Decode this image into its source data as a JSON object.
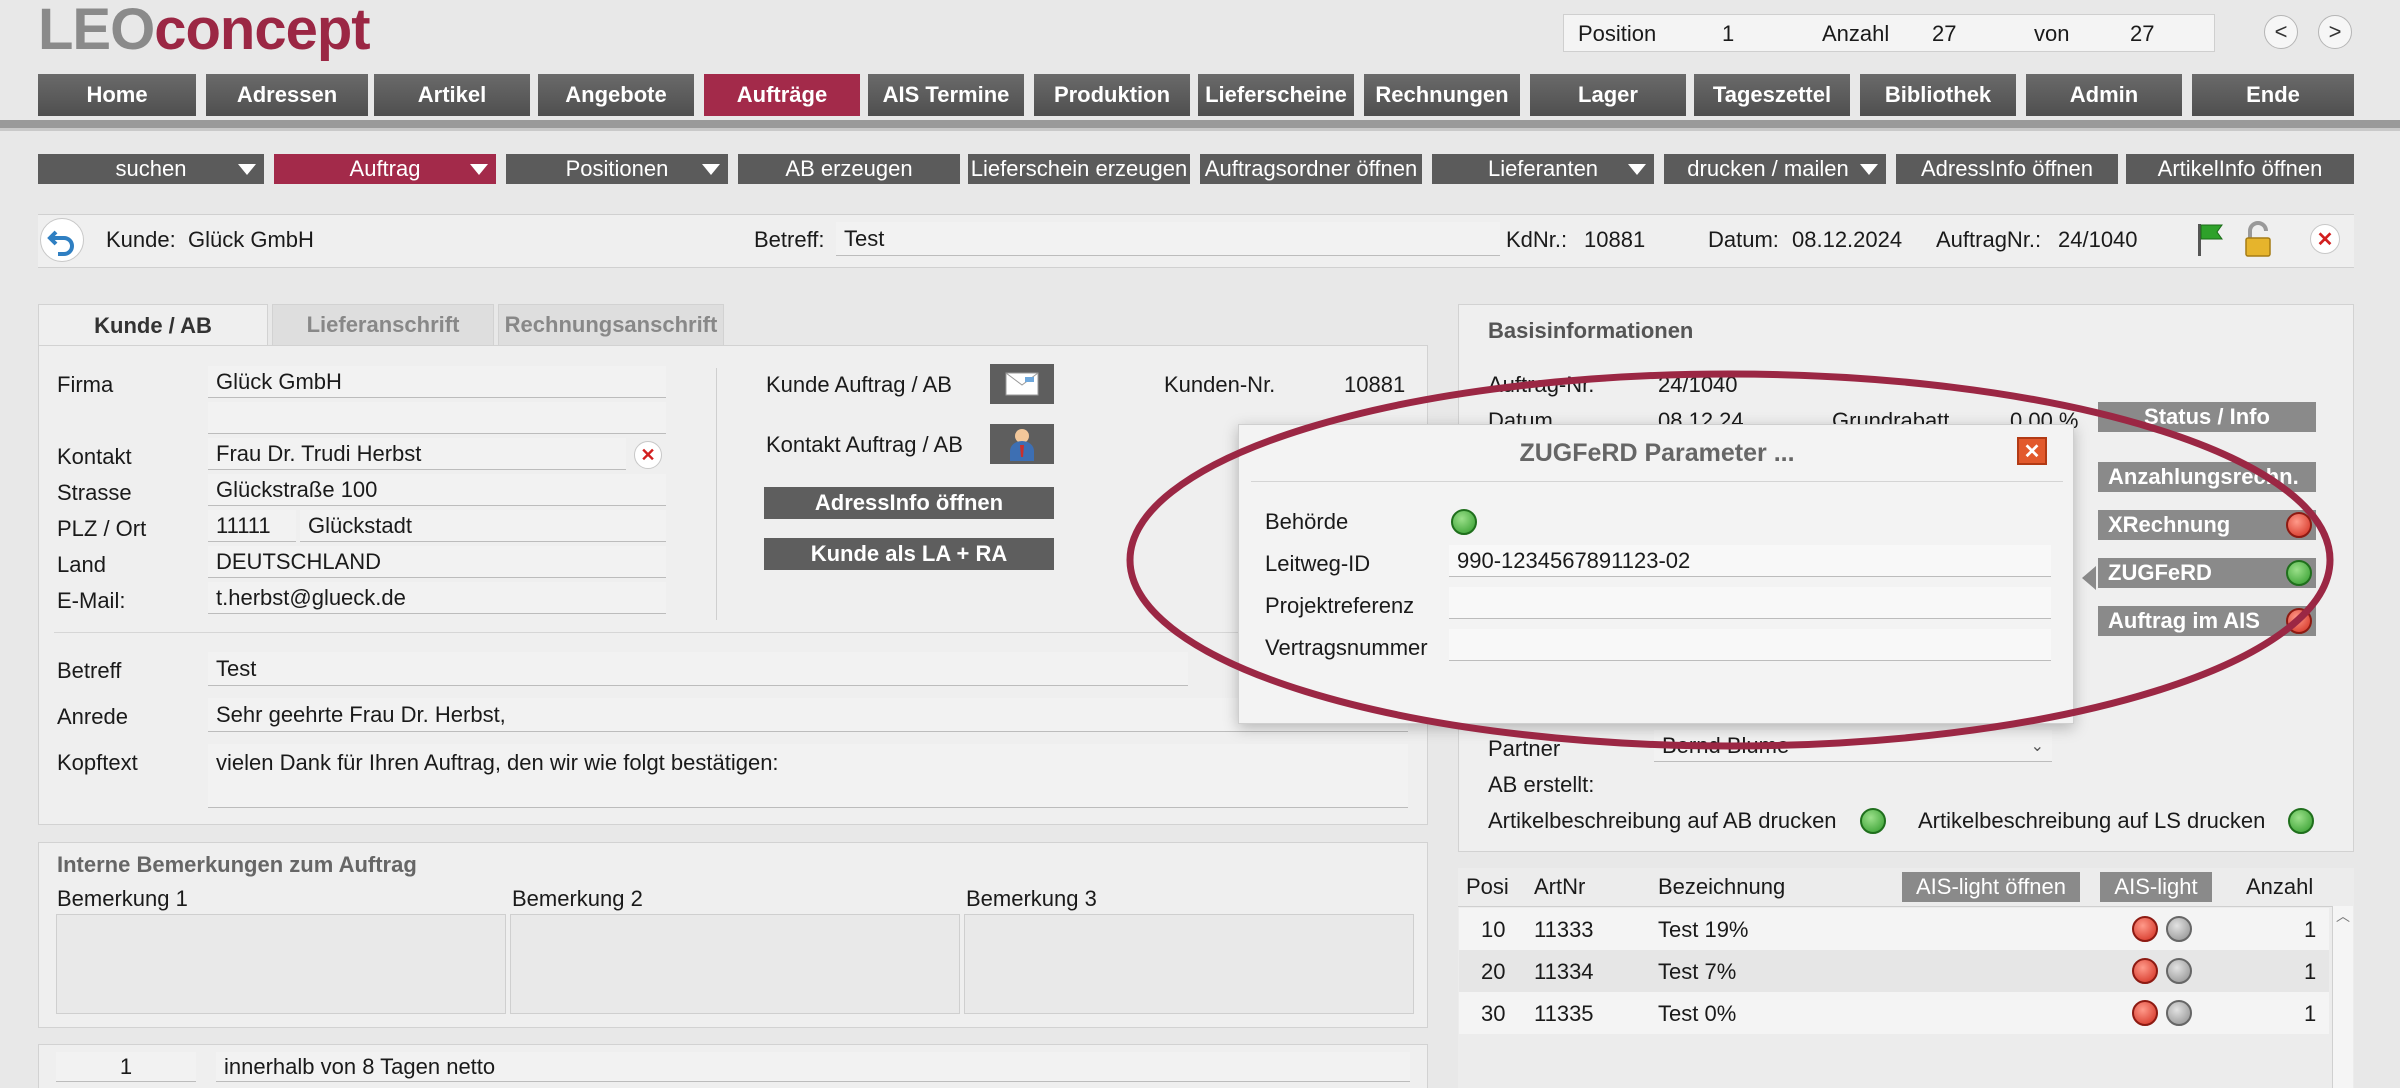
{
  "logo": {
    "part1": "LEO",
    "part2": "concept"
  },
  "position": {
    "label_pos": "Position",
    "pos": "1",
    "label_anz": "Anzahl",
    "anz": "27",
    "label_von": "von",
    "von": "27"
  },
  "nav": {
    "prev": "<",
    "next": ">"
  },
  "menu": [
    "Home",
    "Adressen",
    "Artikel",
    "Angebote",
    "Aufträge",
    "AIS Termine",
    "Produktion",
    "Lieferscheine",
    "Rechnungen",
    "Lager",
    "Tageszettel",
    "Bibliothek",
    "Admin",
    "Ende"
  ],
  "toolbar": {
    "suchen": "suchen",
    "auftrag": "Auftrag",
    "positionen": "Positionen",
    "ab": "AB erzeugen",
    "ls": "Lieferschein erzeugen",
    "ordner": "Auftragsordner öffnen",
    "lieferanten": "Lieferanten",
    "drucken": "drucken / mailen",
    "adressinfo": "AdressInfo öffnen",
    "artikelinfo": "ArtikelInfo öffnen"
  },
  "header": {
    "kunde_label": "Kunde:",
    "kunde": "Glück GmbH",
    "betreff_label": "Betreff:",
    "betreff": "Test",
    "kdnr_label": "KdNr.:",
    "kdnr": "10881",
    "datum_label": "Datum:",
    "datum": "08.12.2024",
    "auftragnr_label": "AuftragNr.:",
    "auftragnr": "24/1040"
  },
  "tabs": {
    "t1": "Kunde / AB",
    "t2": "Lieferanschrift",
    "t3": "Rechnungsanschrift"
  },
  "customer": {
    "firma_label": "Firma",
    "firma": "Glück GmbH",
    "kontakt_label": "Kontakt",
    "kontakt": "Frau Dr. Trudi Herbst",
    "strasse_label": "Strasse",
    "strasse": "Glückstraße 100",
    "plz_label": "PLZ / Ort",
    "plz": "11111",
    "ort": "Glückstadt",
    "land_label": "Land",
    "land": "DEUTSCHLAND",
    "email_label": "E-Mail:",
    "email": "t.herbst@glueck.de",
    "kunde_ab": "Kunde Auftrag / AB",
    "kontakt_ab": "Kontakt Auftrag / AB",
    "adressinfo_btn": "AdressInfo öffnen",
    "la_ra_btn": "Kunde als LA + RA",
    "kundennr_label": "Kunden-Nr.",
    "kundennr": "10881",
    "betreff_label": "Betreff",
    "betreff": "Test",
    "anrede_label": "Anrede",
    "anrede": "Sehr geehrte Frau Dr. Herbst,",
    "kopftext_label": "Kopftext",
    "kopftext": "vielen Dank für Ihren Auftrag, den wir wie folgt bestätigen:"
  },
  "remarks": {
    "title": "Interne Bemerkungen zum Auftrag",
    "b1": "Bemerkung 1",
    "b2": "Bemerkung 2",
    "b3": "Bemerkung 3"
  },
  "payment": {
    "num": "1",
    "text": "innerhalb von 8 Tagen netto"
  },
  "basis": {
    "title": "Basisinformationen",
    "auftragnr_label": "Auftrag-Nr.",
    "auftragnr": "24/1040",
    "datum_label": "Datum",
    "datum": "08.12.24",
    "grundrabatt_label": "Grundrabatt",
    "grundrabatt": "0,00 %",
    "partner_label": "Partner",
    "partner": "Bernd Blume",
    "ab_erstellt": "AB erstellt:",
    "art_ab": "Artikelbeschreibung auf AB drucken",
    "art_ls": "Artikelbeschreibung auf LS drucken"
  },
  "side_buttons": {
    "status": "Status / Info",
    "anzahlung": "Anzahlungsrechn.",
    "xrechnung": "XRechnung",
    "zugferd": "ZUGFeRD",
    "ais": "Auftrag im AIS"
  },
  "popup": {
    "title": "ZUGFeRD Parameter ...",
    "behoerde_label": "Behörde",
    "leitweg_label": "Leitweg-ID",
    "leitweg": "990-1234567891123-02",
    "projekt_label": "Projektreferenz",
    "projekt": "",
    "vertrag_label": "Vertragsnummer",
    "vertrag": ""
  },
  "positions_table": {
    "headers": {
      "posi": "Posi",
      "artnr": "ArtNr",
      "bez": "Bezeichnung",
      "ais_open": "AIS-light öffnen",
      "ais_light": "AIS-light",
      "anzahl": "Anzahl"
    },
    "rows": [
      {
        "posi": "10",
        "artnr": "11333",
        "bez": "Test 19%",
        "anzahl": "1"
      },
      {
        "posi": "20",
        "artnr": "11334",
        "bez": "Test 7%",
        "anzahl": "1"
      },
      {
        "posi": "30",
        "artnr": "11335",
        "bez": "Test 0%",
        "anzahl": "1"
      }
    ]
  },
  "colors": {
    "accent": "#a32a4a",
    "menu": "#555555",
    "annotation": "#9b2744"
  }
}
